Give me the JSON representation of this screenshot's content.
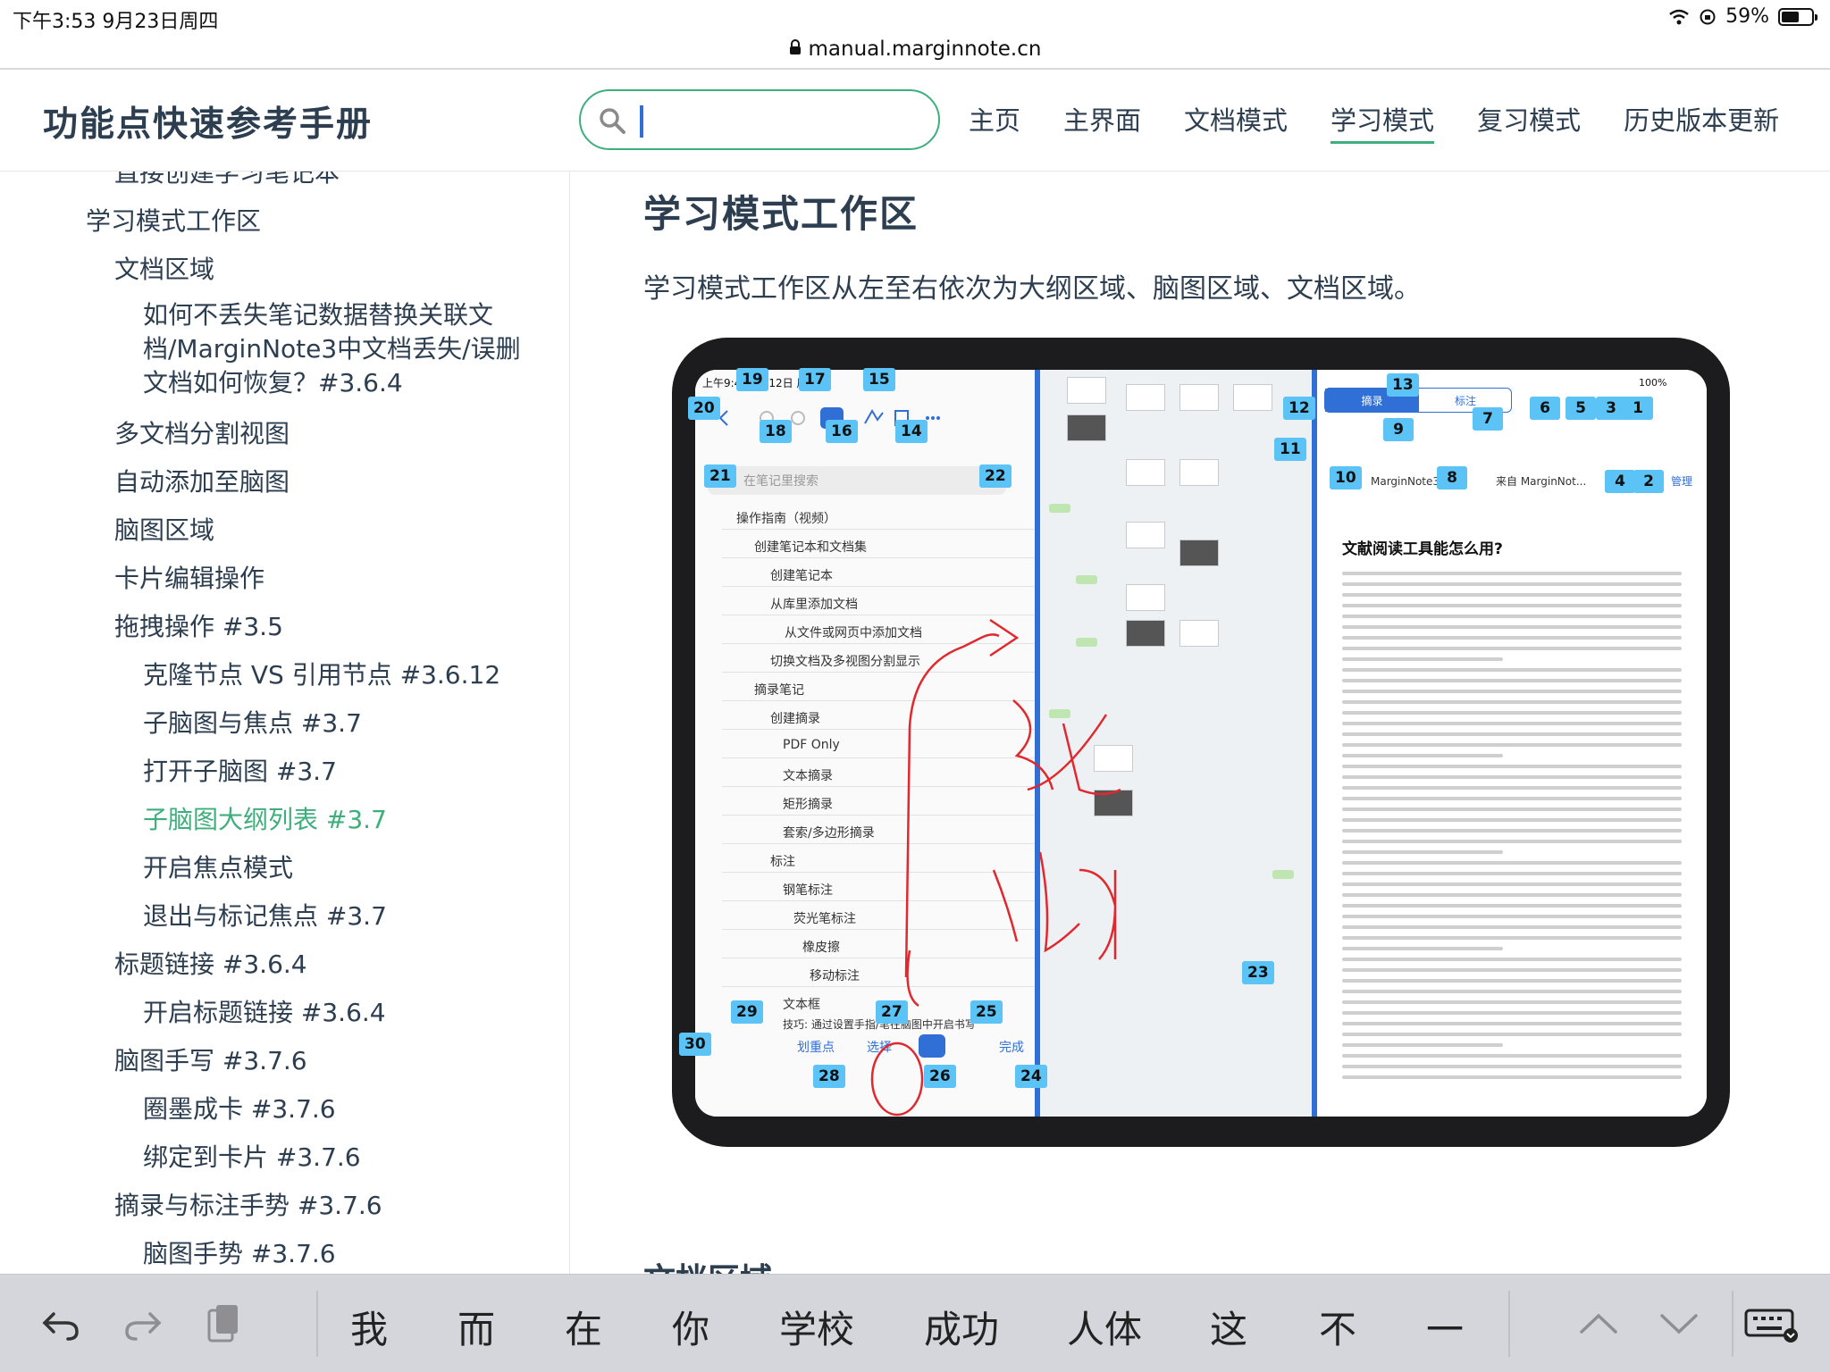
{
  "status_bar": {
    "time": "下午3:53   9月23日周四",
    "battery": "59%",
    "battery_level": 0.59
  },
  "url_bar": {
    "domain": "manual.marginnote.cn"
  },
  "header": {
    "site_title": "功能点快速参考手册",
    "search": {
      "value": "",
      "placeholder": ""
    },
    "nav": [
      {
        "label": "主页"
      },
      {
        "label": "主界面"
      },
      {
        "label": "文档模式"
      },
      {
        "label": "学习模式",
        "active": true
      },
      {
        "label": "复习模式"
      },
      {
        "label": "历史版本更新"
      }
    ]
  },
  "sidebar": {
    "items": [
      {
        "label": "直接创建学习笔记本"
      },
      {
        "label": "学习模式工作区"
      },
      {
        "label": "文档区域"
      },
      {
        "label": "如何不丢失笔记数据替换关联文档/MarginNote3中文档丢失/误删文档如何恢复？#3.6.4"
      },
      {
        "label": "多文档分割视图"
      },
      {
        "label": "自动添加至脑图"
      },
      {
        "label": "脑图区域"
      },
      {
        "label": "卡片编辑操作"
      },
      {
        "label": "拖拽操作 #3.5"
      },
      {
        "label": "克隆节点 VS 引用节点 #3.6.12"
      },
      {
        "label": "子脑图与焦点 #3.7"
      },
      {
        "label": "打开子脑图 #3.7"
      },
      {
        "label": "子脑图大纲列表 #3.7",
        "active": true
      },
      {
        "label": "开启焦点模式"
      },
      {
        "label": "退出与标记焦点 #3.7"
      },
      {
        "label": "标题链接 #3.6.4"
      },
      {
        "label": "开启标题链接 #3.6.4"
      },
      {
        "label": "脑图手写 #3.7.6"
      },
      {
        "label": "圈墨成卡 #3.7.6"
      },
      {
        "label": "绑定到卡片 #3.7.6"
      },
      {
        "label": "摘录与标注手势 #3.7.6"
      },
      {
        "label": "脑图手势 #3.7.6"
      }
    ]
  },
  "main": {
    "heading": "学习模式工作区",
    "paragraph": "学习模式工作区从左至右依次为大纲区域、脑图区域、文档区域。",
    "next_heading": "文档区域"
  },
  "screenshot": {
    "time": "上午9:41  9月12日 周三",
    "search_placeholder": "在笔记里搜索",
    "outline": [
      "操作指南（视频）",
      "创建笔记本和文档集",
      "创建笔记本",
      "从库里添加文档",
      "从文件或网页中添加文档",
      "切换文档及多视图分割显示",
      "摘录笔记",
      "创建摘录",
      "PDF Only",
      "文本摘录",
      "矩形摘录",
      "套索/多边形摘录",
      "标注",
      "钢笔标注",
      "荧光笔标注",
      "橡皮擦",
      "移动标注",
      "文本框",
      "技巧: 通过设置手指/笔在脑图中开启书写"
    ],
    "toolbar": {
      "highlight": "划重点",
      "select": "选择",
      "done": "完成"
    },
    "segment": {
      "excerpt": "摘录",
      "annotate": "标注"
    },
    "doc_tab_1": "MarginNote3演",
    "doc_tab_2": "来自 MarginNot...",
    "manage": "管理",
    "battery": "100%",
    "doc_title": "文献阅读工具能怎么用?",
    "numbered_tags": [
      "1",
      "2",
      "3",
      "4",
      "5",
      "6",
      "7",
      "8",
      "9",
      "10",
      "11",
      "12",
      "13",
      "14",
      "15",
      "16",
      "17",
      "18",
      "19",
      "20",
      "21",
      "22",
      "23",
      "24",
      "25",
      "26",
      "27",
      "28",
      "29",
      "30"
    ]
  },
  "keyboard_bar": {
    "candidates": [
      "我",
      "而",
      "在",
      "你",
      "学校",
      "成功",
      "人体",
      "这",
      "不",
      "一"
    ]
  },
  "colors": {
    "accent": "#3eaf7c",
    "heading": "#2c3e50",
    "tag": "#5bc3f5",
    "ink": "#e0282e",
    "ipad_blue": "#2f6fd6"
  },
  "icons": [
    "search-icon",
    "lock-icon",
    "wifi-icon",
    "battery-icon",
    "undo-icon",
    "redo-icon",
    "clipboard-icon",
    "chevron-up-icon",
    "chevron-down-icon",
    "keyboard-icon"
  ]
}
